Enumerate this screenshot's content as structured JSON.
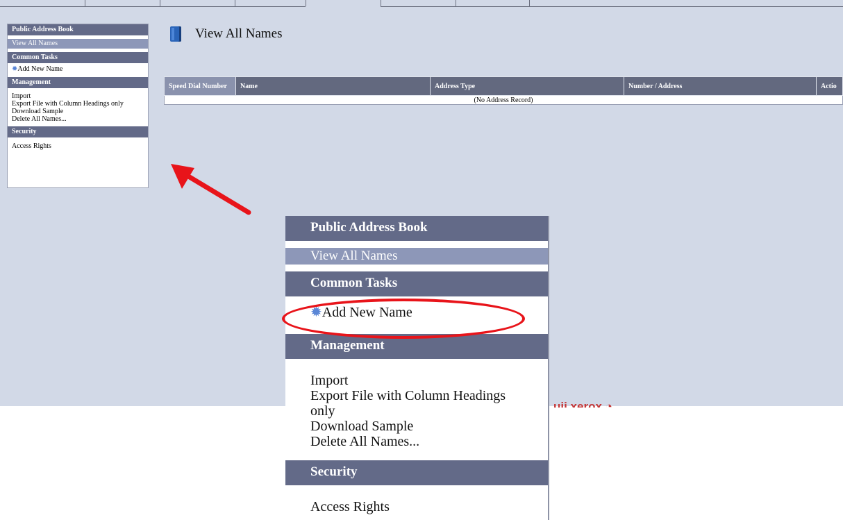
{
  "sidebar": {
    "section1": "Public Address Book",
    "selected": "View All Names",
    "section2": "Common Tasks",
    "add_new": "Add New Name",
    "section3": "Management",
    "import": "Import",
    "export": "Export File with Column Headings only",
    "download": "Download Sample",
    "delete": "Delete All Names...",
    "section4": "Security",
    "access": "Access Rights"
  },
  "main": {
    "title": "View All Names",
    "table": {
      "headers": [
        "Speed Dial Number",
        "Name",
        "Address Type",
        "Number / Address",
        "Actio"
      ],
      "empty_text": "(No Address Record)"
    }
  },
  "zoom_panel": {
    "section1": "Public Address Book",
    "selected": "View All Names",
    "section2": "Common Tasks",
    "add_new": "Add New Name",
    "section3": "Management",
    "import": "Import",
    "export_line1": "Export File with Column Headings",
    "export_line2": "only",
    "download": "Download Sample",
    "delete": "Delete All Names...",
    "section4": "Security",
    "access": "Access Rights"
  },
  "branding": {
    "logo_text": "uji xerox"
  },
  "icons": {
    "gear": "gear-icon",
    "book": "address-book-icon",
    "arrow": "red-arrow-annotation"
  },
  "colors": {
    "page_bg": "#d2d9e7",
    "header_bg": "#636a88",
    "selected_bg": "#8d97b8",
    "annotation_red": "#e8141a"
  }
}
